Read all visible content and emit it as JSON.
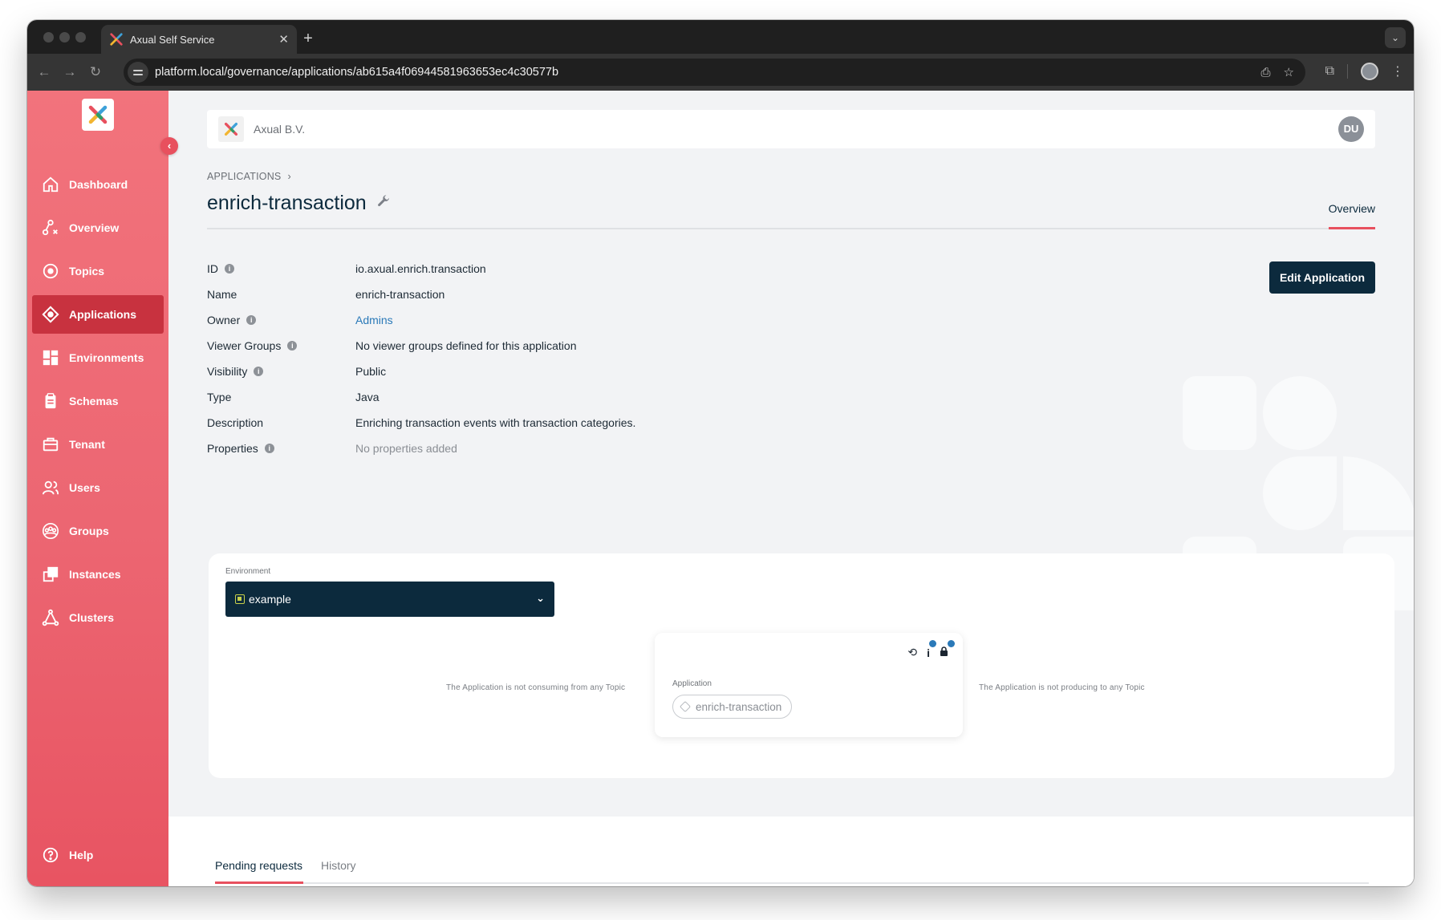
{
  "browser": {
    "tab_title": "Axual Self Service",
    "tab_close": "✕",
    "new_tab": "+",
    "url": "platform.local/governance/applications/ab615a4f06944581963653ec4c30577b"
  },
  "sidebar": {
    "collapse_glyph": "‹",
    "items": [
      {
        "label": "Dashboard",
        "icon": "home-icon"
      },
      {
        "label": "Overview",
        "icon": "overview-icon"
      },
      {
        "label": "Topics",
        "icon": "topics-icon"
      },
      {
        "label": "Applications",
        "icon": "applications-icon",
        "active": true
      },
      {
        "label": "Environments",
        "icon": "environments-icon"
      },
      {
        "label": "Schemas",
        "icon": "schemas-icon"
      },
      {
        "label": "Tenant",
        "icon": "tenant-icon"
      },
      {
        "label": "Users",
        "icon": "users-icon"
      },
      {
        "label": "Groups",
        "icon": "groups-icon"
      },
      {
        "label": "Instances",
        "icon": "instances-icon"
      },
      {
        "label": "Clusters",
        "icon": "clusters-icon"
      }
    ],
    "help": "Help"
  },
  "header": {
    "org_name": "Axual B.V.",
    "user_initials": "DU"
  },
  "breadcrumb": {
    "label": "APPLICATIONS",
    "separator": "›"
  },
  "page": {
    "title": "enrich-transaction",
    "tab_overview": "Overview",
    "edit_button": "Edit Application"
  },
  "details": {
    "id": {
      "label": "ID",
      "value": "io.axual.enrich.transaction"
    },
    "name": {
      "label": "Name",
      "value": "enrich-transaction"
    },
    "owner": {
      "label": "Owner",
      "value": "Admins"
    },
    "viewer_groups": {
      "label": "Viewer Groups",
      "value": "No viewer groups defined for this application"
    },
    "visibility": {
      "label": "Visibility",
      "value": "Public"
    },
    "type": {
      "label": "Type",
      "value": "Java"
    },
    "description": {
      "label": "Description",
      "value": "Enriching transaction events with transaction categories."
    },
    "properties": {
      "label": "Properties",
      "value": "No properties added"
    },
    "info_glyph": "i"
  },
  "graph": {
    "env_label": "Environment",
    "env_value": "example",
    "consuming_note": "The Application is not consuming from any Topic",
    "producing_note": "The Application is not producing to any Topic",
    "node_label": "Application",
    "node_name": "enrich-transaction"
  },
  "lower_tabs": {
    "pending": "Pending requests",
    "history": "History"
  },
  "colors": {
    "sidebar_top": "#f2737c",
    "sidebar_active": "#c8323f",
    "navy": "#0c2a3d",
    "accent": "#e8505e",
    "link": "#2a79b8"
  }
}
